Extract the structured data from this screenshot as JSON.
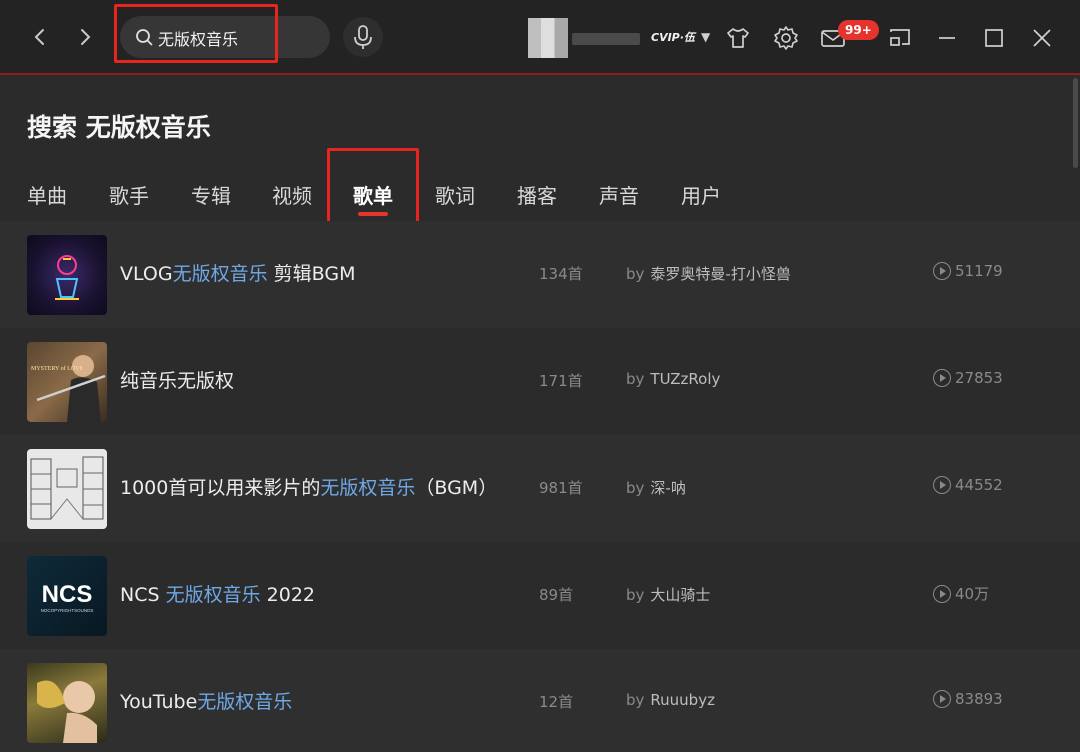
{
  "topbar": {
    "back_icon": "chevron-left-icon",
    "forward_icon": "chevron-right-icon",
    "search_value": "无版权音乐",
    "vip_label": "CVIP·伍",
    "notification_count": "99+"
  },
  "page_title": "搜索 无版权音乐",
  "tabs": [
    {
      "label": "单曲"
    },
    {
      "label": "歌手"
    },
    {
      "label": "专辑"
    },
    {
      "label": "视频"
    },
    {
      "label": "歌单",
      "active": true
    },
    {
      "label": "歌词"
    },
    {
      "label": "播客"
    },
    {
      "label": "声音"
    },
    {
      "label": "用户"
    }
  ],
  "playlists": [
    {
      "title_pre": "VLOG",
      "title_hl": "无版权音乐",
      "title_post": " 剪辑BGM",
      "count": "134首",
      "by": "by",
      "owner": "泰罗奥特曼-打小怪兽",
      "plays": "51179"
    },
    {
      "title_pre": "纯音乐无版权",
      "title_hl": "",
      "title_post": "",
      "count": "171首",
      "by": "by",
      "owner": "TUZzRoly",
      "plays": "27853"
    },
    {
      "title_pre": "1000首可以用来影片的",
      "title_hl": "无版权音乐",
      "title_post": "（BGM）",
      "count": "981首",
      "by": "by",
      "owner": "深-呐",
      "plays": "44552"
    },
    {
      "title_pre": "NCS ",
      "title_hl": "无版权音乐",
      "title_post": " 2022",
      "count": "89首",
      "by": "by",
      "owner": "大山骑士",
      "plays": "40万"
    },
    {
      "title_pre": "YouTube",
      "title_hl": "无版权音乐",
      "title_post": "",
      "count": "12首",
      "by": "by",
      "owner": "Ruuubyz",
      "plays": "83893"
    }
  ],
  "cover_texts": {
    "ncs": "NCS",
    "ncs_sub": "NOCOPYRIGHTSOUNDS",
    "flute_title": "MYSTERY of LOVE"
  },
  "colors": {
    "background": "#2b2b2b",
    "highlight": "#6fa8e6",
    "accent_red": "#e5332d",
    "annotation_frame": "#e5251e"
  }
}
